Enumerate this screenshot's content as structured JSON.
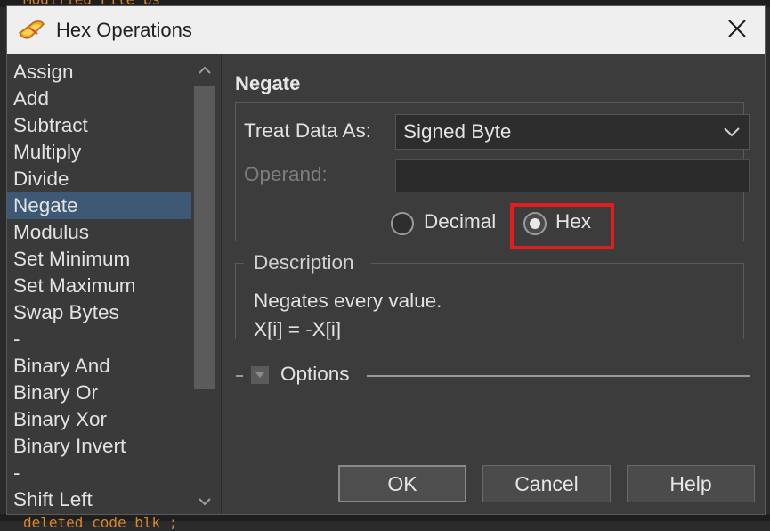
{
  "background": {
    "top_text": "Modified File bs",
    "bottom_text": "deleted code blk ;"
  },
  "dialog": {
    "title": "Hex Operations",
    "app_icon": "hex-editor-app-icon",
    "close_icon": "close-icon"
  },
  "operations": {
    "items": [
      {
        "label": "Assign"
      },
      {
        "label": "Add"
      },
      {
        "label": "Subtract"
      },
      {
        "label": "Multiply"
      },
      {
        "label": "Divide"
      },
      {
        "label": "Negate",
        "selected": true
      },
      {
        "label": "Modulus"
      },
      {
        "label": "Set Minimum"
      },
      {
        "label": "Set Maximum"
      },
      {
        "label": "Swap Bytes"
      },
      {
        "label": "-"
      },
      {
        "label": "Binary And"
      },
      {
        "label": "Binary Or"
      },
      {
        "label": "Binary Xor"
      },
      {
        "label": "Binary Invert"
      },
      {
        "label": "-"
      },
      {
        "label": "Shift Left"
      }
    ]
  },
  "panel": {
    "section_title": "Negate",
    "treat_label": "Treat Data As:",
    "treat_value": "Signed Byte",
    "operand_label": "Operand:",
    "operand_value": "",
    "radio_decimal": "Decimal",
    "radio_hex": "Hex",
    "selected_radio": "Hex"
  },
  "description": {
    "title": "Description",
    "line1": "Negates every value.",
    "line2": "X[i] = -X[i]"
  },
  "options": {
    "label": "Options",
    "expanded": false
  },
  "buttons": {
    "ok": "OK",
    "cancel": "Cancel",
    "help": "Help"
  },
  "colors": {
    "selection": "#3d5975",
    "highlight_box": "#e11d1d",
    "bg_code_text": "#d9862a"
  }
}
